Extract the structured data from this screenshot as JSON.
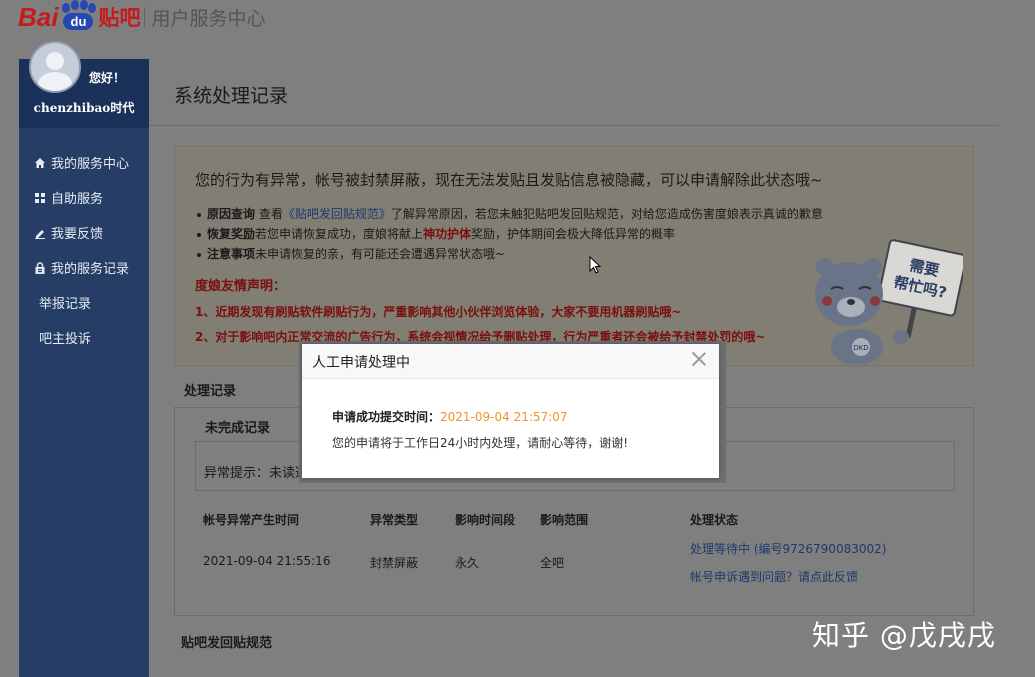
{
  "header": {
    "logo_bai": "Bai",
    "logo_du": "du",
    "logo_tieba": "贴吧",
    "subtitle": "用户服务中心"
  },
  "sidebar": {
    "greeting": "您好！",
    "username": "chenzhibao时代",
    "items": [
      {
        "label": "我的服务中心",
        "icon": "home-icon"
      },
      {
        "label": "自助服务",
        "icon": "grid-icon"
      },
      {
        "label": "我要反馈",
        "icon": "edit-icon"
      },
      {
        "label": "我的服务记录",
        "icon": "lock-icon"
      },
      {
        "label": "举报记录",
        "icon": ""
      },
      {
        "label": "吧主投诉",
        "icon": ""
      }
    ]
  },
  "main": {
    "title": "系统处理记录",
    "notice": {
      "headline": "您的行为有异常，帐号被封禁屏蔽，现在无法发贴且发贴信息被隐藏，可以申请解除此状态哦~",
      "item1_label": "原因查询",
      "item1_pre": "查看",
      "item1_link": "《贴吧发回贴规范》",
      "item1_post": "了解异常原因，若您未触犯贴吧发回贴规范，对给您造成伤害度娘表示真诚的歉意",
      "item2_label": "恢复奖励",
      "item2_pre": "若您申请恢复成功，度娘将献上",
      "item2_red": "神功护体",
      "item2_post": "奖励，护体期间会极大降低异常的概率",
      "item3_label": "注意事项",
      "item3_text": "未申请恢复的亲，有可能还会遭遇异常状态哦~",
      "decl_title": "度娘友情声明：",
      "decl1": "1、近期发现有刷贴软件刷贴行为，严重影响其他小伙伴浏览体验，大家不要用机器刷贴哦~",
      "decl2": "2、对于影响吧内正常交流的广告行为，系统会视情况给予删贴处理，行为严重者还会被给予封禁处罚的哦~",
      "bear_sign_line1": "需要",
      "bear_sign_line2": "帮忙吗?",
      "bear_badge": "DKD"
    },
    "records_title": "处理记录",
    "records_tab": "未完成记录",
    "hint": "异常提示：未读通",
    "table": {
      "headers": [
        "帐号异常产生时间",
        "异常类型",
        "影响时间段",
        "影响范围",
        "处理状态"
      ],
      "row": [
        "2021-09-04 21:55:16",
        "封禁屏蔽",
        "永久",
        "全吧"
      ],
      "status_pending": "处理等待中 (编号9726790083002)",
      "status_feedback": "帐号申诉遇到问题？请点此反馈"
    },
    "rules_title": "贴吧发回贴规范"
  },
  "modal": {
    "title": "人工申请处理中",
    "submit_label": "申请成功提交时间：",
    "submit_time": "2021-09-04 21:57:07",
    "message": "您的申请将于工作日24小时内处理，请耐心等待，谢谢!"
  },
  "watermark": "知乎 @戊戌戌"
}
